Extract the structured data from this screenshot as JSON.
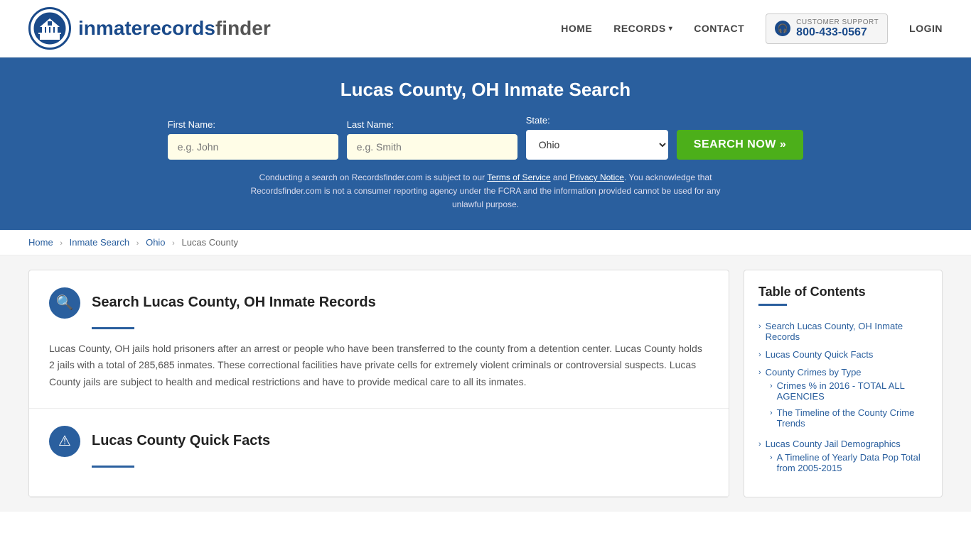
{
  "header": {
    "logo_text_normal": "inmaterecords",
    "logo_text_bold": "finder",
    "nav": {
      "home": "HOME",
      "records": "RECORDS",
      "contact": "CONTACT",
      "login": "LOGIN"
    },
    "support": {
      "label": "CUSTOMER SUPPORT",
      "number": "800-433-0567"
    }
  },
  "hero": {
    "title": "Lucas County, OH Inmate Search",
    "form": {
      "first_name_label": "First Name:",
      "first_name_placeholder": "e.g. John",
      "last_name_label": "Last Name:",
      "last_name_placeholder": "e.g. Smith",
      "state_label": "State:",
      "state_value": "Ohio",
      "search_button": "SEARCH NOW »"
    },
    "disclaimer": "Conducting a search on Recordsfinder.com is subject to our Terms of Service and Privacy Notice. You acknowledge that Recordsfinder.com is not a consumer reporting agency under the FCRA and the information provided cannot be used for any unlawful purpose."
  },
  "breadcrumb": {
    "home": "Home",
    "inmate_search": "Inmate Search",
    "ohio": "Ohio",
    "lucas_county": "Lucas County"
  },
  "sections": [
    {
      "id": "search-records",
      "icon": "🔍",
      "title": "Search Lucas County, OH Inmate Records",
      "text": "Lucas County, OH jails hold prisoners after an arrest or people who have been transferred to the county from a detention center. Lucas County holds 2 jails with a total of 285,685 inmates. These correctional facilities have private cells for extremely violent criminals or controversial suspects. Lucas County jails are subject to health and medical restrictions and have to provide medical care to all its inmates."
    },
    {
      "id": "quick-facts",
      "icon": "⚠",
      "title": "Lucas County Quick Facts",
      "text": ""
    }
  ],
  "toc": {
    "title": "Table of Contents",
    "items": [
      {
        "label": "Search Lucas County, OH Inmate Records",
        "sub": false
      },
      {
        "label": "Lucas County Quick Facts",
        "sub": false
      },
      {
        "label": "County Crimes by Type",
        "sub": false
      },
      {
        "label": "Crimes % in 2016 - TOTAL ALL AGENCIES",
        "sub": true
      },
      {
        "label": "The Timeline of the County Crime Trends",
        "sub": true
      },
      {
        "label": "Lucas County Jail Demographics",
        "sub": false
      },
      {
        "label": "A Timeline of Yearly Data Pop Total from 2005-2015",
        "sub": true
      }
    ]
  }
}
